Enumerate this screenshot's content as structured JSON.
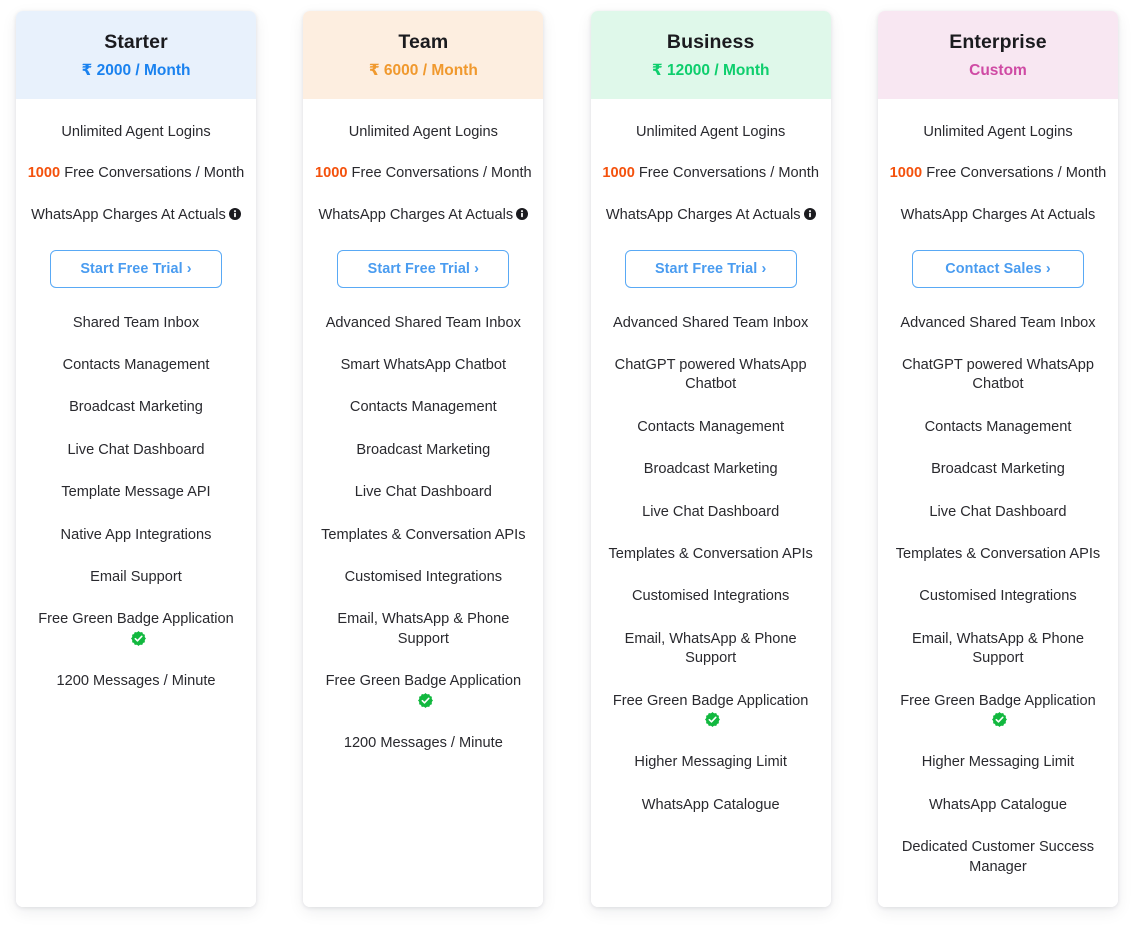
{
  "colors": {
    "starter_header_bg": "#e8f1fc",
    "starter_price": "#1a82ef",
    "team_header_bg": "#fdeee0",
    "team_price": "#f0992e",
    "business_header_bg": "#dff8ea",
    "business_price": "#0ece6d",
    "enterprise_header_bg": "#f8e7f2",
    "enterprise_price": "#cf4aa4",
    "cta_border": "#59a9f5",
    "cta_text": "#4a9cf0",
    "count_highlight": "#f4510c",
    "verified_green": "#12b83f",
    "body_text": "#29292e"
  },
  "plans": [
    {
      "name": "Starter",
      "price_currency": "₹",
      "price_amount": "2000",
      "price_separator": "/",
      "price_period": "Month",
      "price_full": "₹ 2000 / Month",
      "highlights": [
        {
          "text": "Unlimited Agent Logins",
          "count": null,
          "info_icon": false
        },
        {
          "text": "Free Conversations / Month",
          "count": "1000",
          "info_icon": false
        },
        {
          "text": "WhatsApp Charges At Actuals",
          "count": null,
          "info_icon": true
        }
      ],
      "cta_label": "Start Free Trial ›",
      "features": [
        {
          "text": "Shared Team Inbox",
          "verified": false
        },
        {
          "text": "Contacts Management",
          "verified": false
        },
        {
          "text": "Broadcast Marketing",
          "verified": false
        },
        {
          "text": "Live Chat Dashboard",
          "verified": false
        },
        {
          "text": "Template Message API",
          "verified": false
        },
        {
          "text": "Native App Integrations",
          "verified": false
        },
        {
          "text": "Email Support",
          "verified": false
        },
        {
          "text": "Free Green Badge Application",
          "verified": true
        },
        {
          "text": "1200 Messages / Minute",
          "verified": false
        }
      ]
    },
    {
      "name": "Team",
      "price_currency": "₹",
      "price_amount": "6000",
      "price_separator": "/",
      "price_period": "Month",
      "price_full": "₹ 6000 / Month",
      "highlights": [
        {
          "text": "Unlimited Agent Logins",
          "count": null,
          "info_icon": false
        },
        {
          "text": "Free Conversations / Month",
          "count": "1000",
          "info_icon": false
        },
        {
          "text": "WhatsApp Charges At Actuals",
          "count": null,
          "info_icon": true
        }
      ],
      "cta_label": "Start Free Trial ›",
      "features": [
        {
          "text": "Advanced Shared Team Inbox",
          "verified": false
        },
        {
          "text": "Smart WhatsApp Chatbot",
          "verified": false
        },
        {
          "text": "Contacts Management",
          "verified": false
        },
        {
          "text": "Broadcast Marketing",
          "verified": false
        },
        {
          "text": "Live Chat Dashboard",
          "verified": false
        },
        {
          "text": "Templates & Conversation APIs",
          "verified": false
        },
        {
          "text": "Customised Integrations",
          "verified": false
        },
        {
          "text": "Email, WhatsApp & Phone Support",
          "verified": false
        },
        {
          "text": "Free Green Badge Application",
          "verified": true
        },
        {
          "text": "1200 Messages / Minute",
          "verified": false
        }
      ]
    },
    {
      "name": "Business",
      "price_currency": "₹",
      "price_amount": "12000",
      "price_separator": "/",
      "price_period": "Month",
      "price_full": "₹ 12000 / Month",
      "highlights": [
        {
          "text": "Unlimited Agent Logins",
          "count": null,
          "info_icon": false
        },
        {
          "text": "Free Conversations / Month",
          "count": "1000",
          "info_icon": false
        },
        {
          "text": "WhatsApp Charges At Actuals",
          "count": null,
          "info_icon": true
        }
      ],
      "cta_label": "Start Free Trial ›",
      "features": [
        {
          "text": "Advanced Shared Team Inbox",
          "verified": false
        },
        {
          "text": "ChatGPT powered WhatsApp Chatbot",
          "verified": false
        },
        {
          "text": "Contacts Management",
          "verified": false
        },
        {
          "text": "Broadcast Marketing",
          "verified": false
        },
        {
          "text": "Live Chat Dashboard",
          "verified": false
        },
        {
          "text": "Templates & Conversation APIs",
          "verified": false
        },
        {
          "text": "Customised Integrations",
          "verified": false
        },
        {
          "text": "Email, WhatsApp & Phone Support",
          "verified": false
        },
        {
          "text": "Free Green Badge Application",
          "verified": true
        },
        {
          "text": "Higher Messaging Limit",
          "verified": false
        },
        {
          "text": "WhatsApp Catalogue",
          "verified": false
        }
      ]
    },
    {
      "name": "Enterprise",
      "price_currency": "",
      "price_amount": "",
      "price_separator": "",
      "price_period": "",
      "price_full": "Custom",
      "highlights": [
        {
          "text": "Unlimited Agent Logins",
          "count": null,
          "info_icon": false
        },
        {
          "text": "Free Conversations / Month",
          "count": "1000",
          "info_icon": false
        },
        {
          "text": "WhatsApp Charges At Actuals",
          "count": null,
          "info_icon": false
        }
      ],
      "cta_label": "Contact Sales ›",
      "features": [
        {
          "text": "Advanced Shared Team Inbox",
          "verified": false
        },
        {
          "text": "ChatGPT powered WhatsApp Chatbot",
          "verified": false
        },
        {
          "text": "Contacts Management",
          "verified": false
        },
        {
          "text": "Broadcast Marketing",
          "verified": false
        },
        {
          "text": "Live Chat Dashboard",
          "verified": false
        },
        {
          "text": "Templates & Conversation APIs",
          "verified": false
        },
        {
          "text": "Customised Integrations",
          "verified": false
        },
        {
          "text": "Email, WhatsApp & Phone Support",
          "verified": false
        },
        {
          "text": "Free Green Badge Application",
          "verified": true
        },
        {
          "text": "Higher Messaging Limit",
          "verified": false
        },
        {
          "text": "WhatsApp Catalogue",
          "verified": false
        },
        {
          "text": "Dedicated Customer Success Manager",
          "verified": false
        }
      ]
    }
  ]
}
